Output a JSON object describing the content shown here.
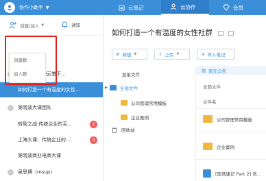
{
  "header": {
    "user_name": "协作小助手",
    "tabs": [
      {
        "label": "云笔记"
      },
      {
        "label": "云协作"
      },
      {
        "label": "会员"
      }
    ]
  },
  "sidebar": {
    "create_add_label": "创建/加入",
    "notify_label": "通知",
    "menu": [
      "创建群",
      "加入群"
    ],
    "items": [
      {
        "label": "网易有道我的云笔下..."
      },
      {
        "label": "如何打造一个有温度的女性..."
      },
      {
        "label": "吴晓波大课团队"
      },
      {
        "label": "转型之战:传统企业的互...",
        "badge": "2"
      },
      {
        "label": "上海大课：传统企业的...",
        "badge": "4"
      },
      {
        "label": "吴晓波商业电商大课"
      },
      {
        "label": "吴思博（msup）"
      }
    ]
  },
  "main": {
    "title": "如何打造一个有温度的女性社群",
    "buttons": [
      "新建",
      "上传",
      "导入笔记"
    ],
    "tree": {
      "starred": "加星文件",
      "all_files": "全部文件",
      "children": [
        "公司管理常用模板",
        "企业案例"
      ],
      "recycle": "回收站"
    },
    "notice": "暂无公告",
    "breadcrumb": "全部文件",
    "column_header": "文件名",
    "files": [
      "公司管理常用模板",
      "企业案例",
      "[现场速记 Part 2] 吾..."
    ]
  },
  "colors": {
    "brand": "#3b8ed8",
    "highlight": "#e0201c",
    "badge": "#ef5d5d",
    "folder": "#f4b73e"
  }
}
